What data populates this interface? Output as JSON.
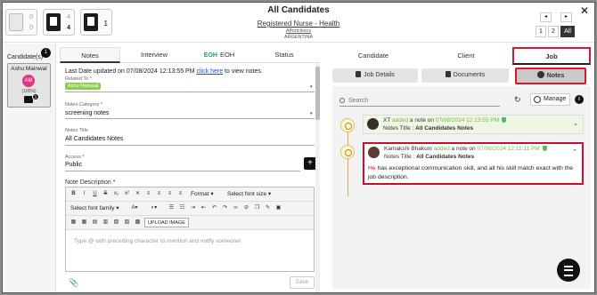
{
  "header": {
    "title": "All Candidates",
    "job_title": "Registered Nurse - Health",
    "company": "Affortclinics",
    "country": "ARGENTINA",
    "tiles": [
      {
        "top": "0",
        "bottom": "0"
      },
      {
        "top": "4",
        "bottom": "4"
      },
      {
        "value": "1"
      }
    ],
    "pages": [
      "1",
      "2",
      "All"
    ],
    "close": "✕"
  },
  "candidates": {
    "label": "Candidate(s)",
    "count": "1",
    "card": {
      "name": "Ashu Mainwal",
      "initials": "AM",
      "percent": "(100%)",
      "badge": "1"
    }
  },
  "middle": {
    "tabs": [
      "Notes",
      "Interview",
      "EOH",
      "Status"
    ],
    "eoh_logo": "EOH",
    "last_updated_prefix": "Last Date updated on 07/08/2024 12:13:55 PM ",
    "last_updated_link": "click here",
    "last_updated_suffix": " to view notes.",
    "related_to_label": "Related To *",
    "related_to_chip": "Ashu Mainwal",
    "notes_category_label": "Notes Category *",
    "notes_category_value": "screening notes",
    "notes_title_label": "Notes Title",
    "notes_title_value": "All Candidates Notes",
    "access_label": "Access *",
    "access_value": "Public",
    "note_description_label": "Note Description *",
    "toolbar": {
      "format": "Format",
      "font_size": "Select font size",
      "font_family": "Select font family",
      "upload_image": "UPLOAD IMAGE"
    },
    "editor_placeholder": "Type @ with preceding character to mention and notify someone!",
    "save": "Save",
    "plus": "+"
  },
  "right": {
    "tabs": [
      "Candidate",
      "Client",
      "Job"
    ],
    "subtabs": [
      "Job Details",
      "Documents",
      "Notes"
    ],
    "search_placeholder": "Search",
    "manage": "Manage",
    "info": "i",
    "notes": [
      {
        "author": "XT",
        "action": "added",
        "mid": " a note on ",
        "date": "07/08/2024 12:13:55 PM",
        "title_label": "Notes Title : ",
        "title": "All Candidates Notes",
        "collapsed": true
      },
      {
        "author": "Kamakshi Bhakuni",
        "action": "added",
        "mid": " a note on ",
        "date": "07/08/2024 12:11:11 PM",
        "title_label": "Notes Title : ",
        "title": "All Candidates Notes",
        "body_first": "He",
        "body_rest": " has exceptional communication skill, and all his skill match exact with the job description.",
        "collapsed": false
      }
    ]
  },
  "colors": {
    "accent_red": "#e0142c",
    "green": "#7ab648",
    "dark": "#111111"
  }
}
